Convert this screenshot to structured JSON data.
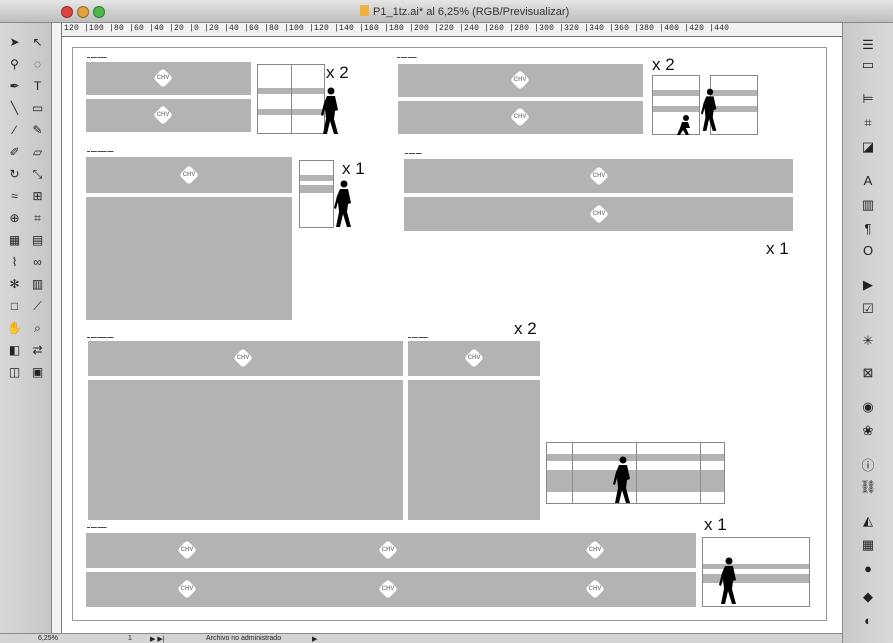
{
  "window": {
    "title": "P1_1tz.ai* al 6,25% (RGB/Previsualizar)"
  },
  "ruler": {
    "top_labels": "120 |100 |80  |60  |40  |20  |0   |20  |40  |60  |80  |100 |120 |140 |160 |180 |200 |220 |240 |260 |280 |300 |320 |340 |360 |380 |400 |420 |440"
  },
  "artwork": {
    "brand_label": "CHV",
    "multipliers": [
      "x 2",
      "x 2",
      "x 1",
      "x 1",
      "x 2",
      "x 1"
    ]
  },
  "statusbar": {
    "zoom": "6,25%",
    "page_value": "1",
    "status_text": "Archivo no administrado"
  },
  "colors": {
    "panel_gray": "#b3b3b3",
    "canvas": "#ffffff",
    "chrome": "#d0d0d0"
  }
}
